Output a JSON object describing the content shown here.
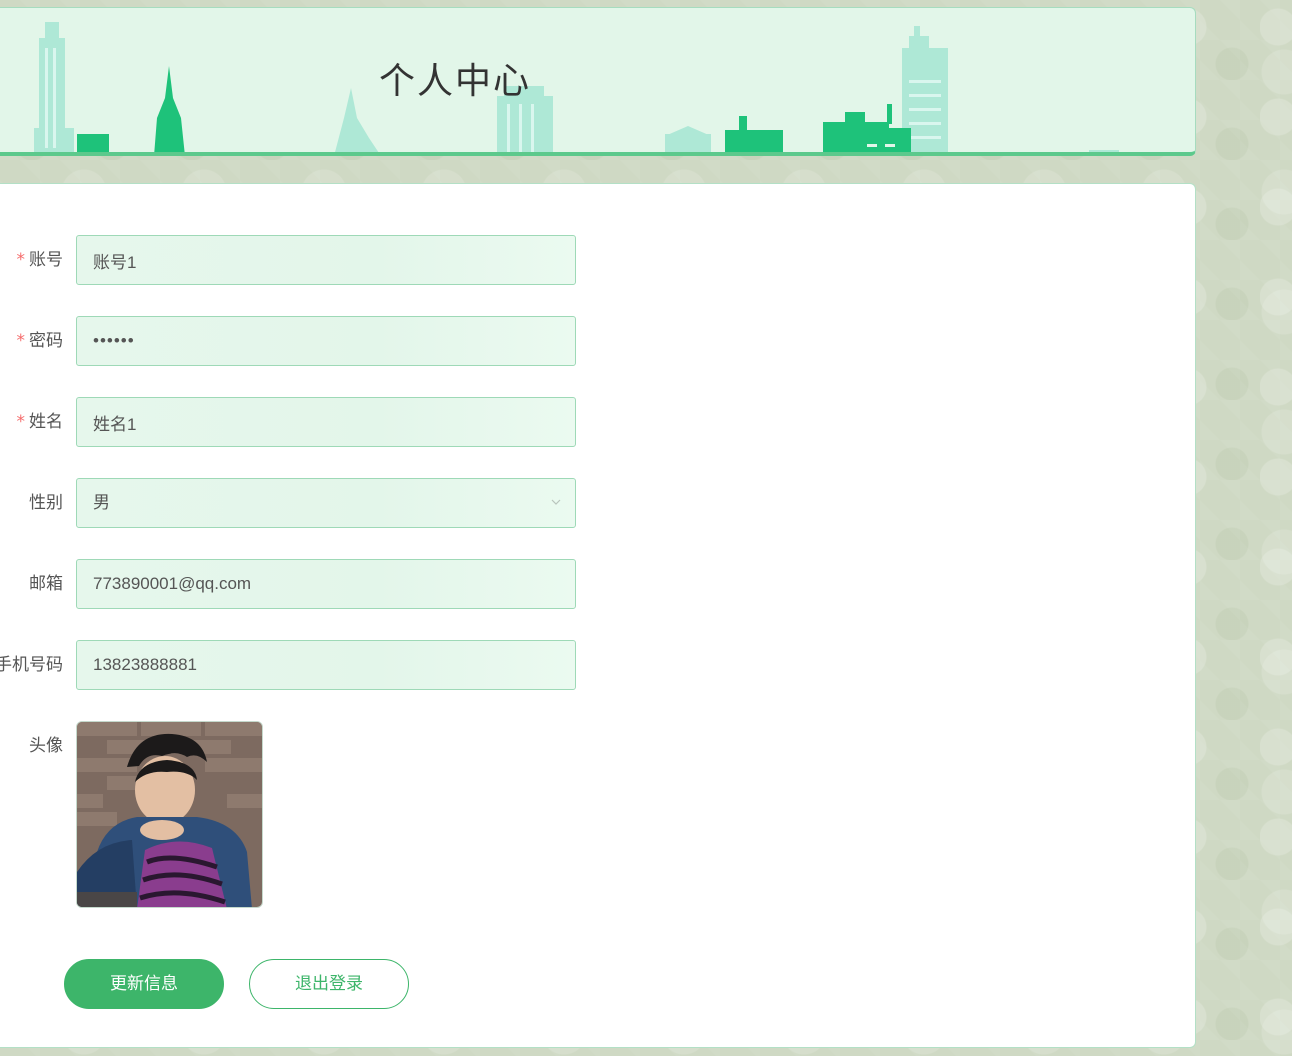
{
  "header": {
    "title": "个人中心"
  },
  "form": {
    "account": {
      "label": "账号",
      "required": true,
      "value": "账号1"
    },
    "password": {
      "label": "密码",
      "required": true,
      "value": "••••••"
    },
    "name": {
      "label": "姓名",
      "required": true,
      "value": "姓名1"
    },
    "gender": {
      "label": "性别",
      "required": false,
      "value": "男"
    },
    "email": {
      "label": "邮箱",
      "required": false,
      "value": "773890001@qq.com"
    },
    "phone": {
      "label": "手机号码",
      "required": false,
      "value": "13823888881"
    },
    "avatar": {
      "label": "头像"
    },
    "required_mark": "*"
  },
  "actions": {
    "update_label": "更新信息",
    "logout_label": "退出登录"
  },
  "colors": {
    "accent": "#3db56a",
    "banner_bg": "#e2f6e9",
    "field_border": "#9ed9b7",
    "required": "#f56c6c"
  },
  "icons": {
    "select_arrow": "chevron-down-icon"
  }
}
